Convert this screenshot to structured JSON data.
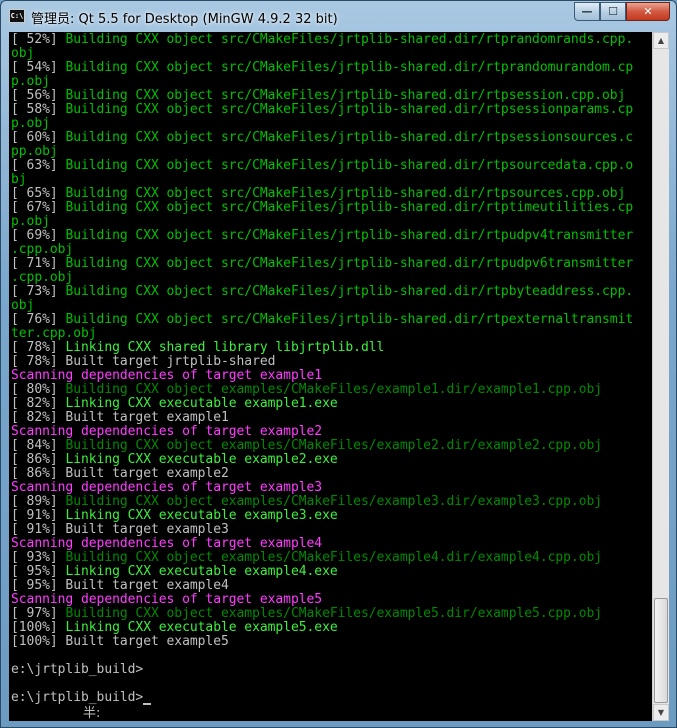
{
  "window": {
    "title": "管理员: Qt 5.5 for Desktop (MinGW 4.9.2 32 bit)",
    "icon_text": "C:\\",
    "minimize_label": "—",
    "maximize_label": "☐",
    "close_label": "✕"
  },
  "console": {
    "lines": [
      {
        "t": "[ 52%] ",
        "c": "w"
      },
      {
        "t": "Building CXX object src/CMakeFiles/jrtplib-shared.dir/rtprandomrands.cpp.",
        "c": "g"
      },
      {
        "t": "obj",
        "c": "g"
      },
      {
        "t": "[ 54%] ",
        "c": "w"
      },
      {
        "t": "Building CXX object src/CMakeFiles/jrtplib-shared.dir/rtprandomurandom.cp",
        "c": "g"
      },
      {
        "t": "p.obj",
        "c": "g"
      },
      {
        "t": "[ 56%] ",
        "c": "w"
      },
      {
        "t": "Building CXX object src/CMakeFiles/jrtplib-shared.dir/rtpsession.cpp.obj",
        "c": "g"
      },
      {
        "t": "[ 58%] ",
        "c": "w"
      },
      {
        "t": "Building CXX object src/CMakeFiles/jrtplib-shared.dir/rtpsessionparams.cp",
        "c": "g"
      },
      {
        "t": "p.obj",
        "c": "g"
      },
      {
        "t": "[ 60%] ",
        "c": "w"
      },
      {
        "t": "Building CXX object src/CMakeFiles/jrtplib-shared.dir/rtpsessionsources.c",
        "c": "g"
      },
      {
        "t": "pp.obj",
        "c": "g"
      },
      {
        "t": "[ 63%] ",
        "c": "w"
      },
      {
        "t": "Building CXX object src/CMakeFiles/jrtplib-shared.dir/rtpsourcedata.cpp.o",
        "c": "g"
      },
      {
        "t": "bj",
        "c": "g"
      },
      {
        "t": "[ 65%] ",
        "c": "w"
      },
      {
        "t": "Building CXX object src/CMakeFiles/jrtplib-shared.dir/rtpsources.cpp.obj",
        "c": "g"
      },
      {
        "t": "[ 67%] ",
        "c": "w"
      },
      {
        "t": "Building CXX object src/CMakeFiles/jrtplib-shared.dir/rtptimeutilities.cp",
        "c": "g"
      },
      {
        "t": "p.obj",
        "c": "g"
      },
      {
        "t": "[ 69%] ",
        "c": "w"
      },
      {
        "t": "Building CXX object src/CMakeFiles/jrtplib-shared.dir/rtpudpv4transmitter",
        "c": "g"
      },
      {
        "t": ".cpp.obj",
        "c": "g"
      },
      {
        "t": "[ 71%] ",
        "c": "w"
      },
      {
        "t": "Building CXX object src/CMakeFiles/jrtplib-shared.dir/rtpudpv6transmitter",
        "c": "g"
      },
      {
        "t": ".cpp.obj",
        "c": "g"
      },
      {
        "t": "[ 73%] ",
        "c": "w"
      },
      {
        "t": "Building CXX object src/CMakeFiles/jrtplib-shared.dir/rtpbyteaddress.cpp.",
        "c": "g"
      },
      {
        "t": "obj",
        "c": "g"
      },
      {
        "t": "[ 76%] ",
        "c": "w"
      },
      {
        "t": "Building CXX object src/CMakeFiles/jrtplib-shared.dir/rtpexternaltransmit",
        "c": "g"
      },
      {
        "t": "ter.cpp.obj",
        "c": "g"
      },
      {
        "t": "[ 78%] ",
        "c": "w"
      },
      {
        "t": "Linking CXX shared library libjrtplib.dll",
        "c": "lg"
      },
      {
        "t": "[ 78%] Built target jrtplib-shared",
        "c": "w"
      },
      {
        "t": "Scanning dependencies of target example1",
        "c": "m"
      },
      {
        "t": "[ 80%] ",
        "c": "w"
      },
      {
        "t": "Building CXX object examples/CMakeFiles/example1.dir/example1.cpp.obj",
        "c": "dg"
      },
      {
        "t": "[ 82%] ",
        "c": "w"
      },
      {
        "t": "Linking CXX executable example1.exe",
        "c": "lg"
      },
      {
        "t": "[ 82%] Built target example1",
        "c": "w"
      },
      {
        "t": "Scanning dependencies of target example2",
        "c": "m"
      },
      {
        "t": "[ 84%] ",
        "c": "w"
      },
      {
        "t": "Building CXX object examples/CMakeFiles/example2.dir/example2.cpp.obj",
        "c": "dg"
      },
      {
        "t": "[ 86%] ",
        "c": "w"
      },
      {
        "t": "Linking CXX executable example2.exe",
        "c": "lg"
      },
      {
        "t": "[ 86%] Built target example2",
        "c": "w"
      },
      {
        "t": "Scanning dependencies of target example3",
        "c": "m"
      },
      {
        "t": "[ 89%] ",
        "c": "w"
      },
      {
        "t": "Building CXX object examples/CMakeFiles/example3.dir/example3.cpp.obj",
        "c": "dg"
      },
      {
        "t": "[ 91%] ",
        "c": "w"
      },
      {
        "t": "Linking CXX executable example3.exe",
        "c": "lg"
      },
      {
        "t": "[ 91%] Built target example3",
        "c": "w"
      },
      {
        "t": "Scanning dependencies of target example4",
        "c": "m"
      },
      {
        "t": "[ 93%] ",
        "c": "w"
      },
      {
        "t": "Building CXX object examples/CMakeFiles/example4.dir/example4.cpp.obj",
        "c": "dg"
      },
      {
        "t": "[ 95%] ",
        "c": "w"
      },
      {
        "t": "Linking CXX executable example4.exe",
        "c": "lg"
      },
      {
        "t": "[ 95%] Built target example4",
        "c": "w"
      },
      {
        "t": "Scanning dependencies of target example5",
        "c": "m"
      },
      {
        "t": "[ 97%] ",
        "c": "w"
      },
      {
        "t": "Building CXX object examples/CMakeFiles/example5.dir/example5.cpp.obj",
        "c": "dg"
      },
      {
        "t": "[100%] ",
        "c": "w"
      },
      {
        "t": "Linking CXX executable example5.exe",
        "c": "lg"
      },
      {
        "t": "[100%] Built target example5",
        "c": "w"
      }
    ],
    "prompt_1": "e:\\jrtplib_build>",
    "prompt_2": "e:\\jrtplib_build>",
    "ime_status": "半:"
  },
  "colors": {
    "text_default": "#c0c0c0",
    "text_building": "#00c000",
    "text_linking": "#3cf03c",
    "text_scanning": "#ff3cff",
    "background": "#000000"
  }
}
